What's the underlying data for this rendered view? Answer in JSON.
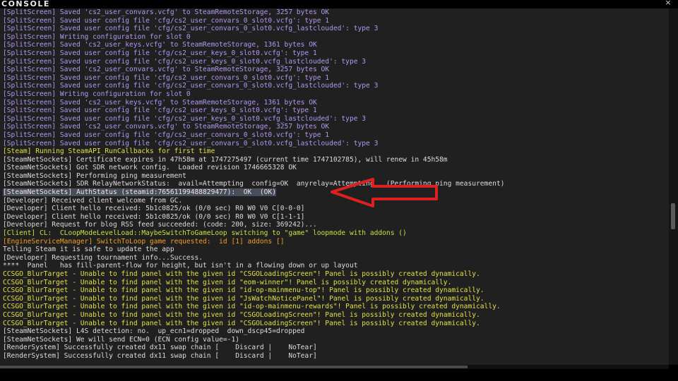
{
  "window": {
    "title": "CONSOLE",
    "close_glyph": "×"
  },
  "console": {
    "lines": [
      {
        "text": "[SplitScreen] Saved 'cs2_user_convars.vcfg' to SteamRemoteStorage, 3257 bytes OK",
        "color": "purple"
      },
      {
        "text": "[SplitScreen] Saved user config file 'cfg/cs2_user_convars_0_slot0.vcfg': type 1",
        "color": "purple"
      },
      {
        "text": "[SplitScreen] Saved user config file 'cfg/cs2_user_convars_0_slot0.vcfg_lastclouded': type 3",
        "color": "purple"
      },
      {
        "text": "[SplitScreen] Writing configuration for slot 0",
        "color": "purple"
      },
      {
        "text": "[SplitScreen] Saved 'cs2_user_keys.vcfg' to SteamRemoteStorage, 1361 bytes OK",
        "color": "purple"
      },
      {
        "text": "[SplitScreen] Saved user config file 'cfg/cs2_user_keys_0_slot0.vcfg': type 1",
        "color": "purple"
      },
      {
        "text": "[SplitScreen] Saved user config file 'cfg/cs2_user_keys_0_slot0.vcfg_lastclouded': type 3",
        "color": "purple"
      },
      {
        "text": "[SplitScreen] Saved 'cs2_user_convars.vcfg' to SteamRemoteStorage, 3257 bytes OK",
        "color": "purple"
      },
      {
        "text": "[SplitScreen] Saved user config file 'cfg/cs2_user_convars_0_slot0.vcfg': type 1",
        "color": "purple"
      },
      {
        "text": "[SplitScreen] Saved user config file 'cfg/cs2_user_convars_0_slot0.vcfg_lastclouded': type 3",
        "color": "purple"
      },
      {
        "text": "[SplitScreen] Writing configuration for slot 0",
        "color": "purple"
      },
      {
        "text": "[SplitScreen] Saved 'cs2_user_keys.vcfg' to SteamRemoteStorage, 1361 bytes OK",
        "color": "purple"
      },
      {
        "text": "[SplitScreen] Saved user config file 'cfg/cs2_user_keys_0_slot0.vcfg': type 1",
        "color": "purple"
      },
      {
        "text": "[SplitScreen] Saved user config file 'cfg/cs2_user_keys_0_slot0.vcfg_lastclouded': type 3",
        "color": "purple"
      },
      {
        "text": "[SplitScreen] Saved 'cs2_user_convars.vcfg' to SteamRemoteStorage, 3257 bytes OK",
        "color": "purple"
      },
      {
        "text": "[SplitScreen] Saved user config file 'cfg/cs2_user_convars_0_slot0.vcfg': type 1",
        "color": "purple"
      },
      {
        "text": "[SplitScreen] Saved user config file 'cfg/cs2_user_convars_0_slot0.vcfg_lastclouded': type 3",
        "color": "purple"
      },
      {
        "text": "[Steam] Running SteamAPI_RunCallbacks for first time",
        "color": "yellow"
      },
      {
        "text": "[SteamNetSockets] Certificate expires in 47h58m at 1747275497 (current time 1747102785), will renew in 45h58m",
        "color": "white"
      },
      {
        "text": "[SteamNetSockets] Got SDR network config.  Loaded revision 1746665328 OK",
        "color": "white"
      },
      {
        "text": "[SteamNetSockets] Performing ping measurement",
        "color": "white"
      },
      {
        "text": "[SteamNetSockets] SDR RelayNetworkStatus:  avail=Attempting  config=OK  anyrelay=Attempting   (Performing ping measurement)",
        "color": "white"
      },
      {
        "text": "[SteamNetSockets] AuthStatus (steamid:76561199488829477):  OK  (OK)",
        "color": "white",
        "highlight": true
      },
      {
        "text": "[Developer] Received client welcome from GC.",
        "color": "white"
      },
      {
        "text": "[Developer] Client hello received: 5b1c0825/ok (0/0 sec) R0 W0 V0 C[0-0-0]",
        "color": "white"
      },
      {
        "text": "[Developer] Client hello received: 5b1c0825/ok (0/0 sec) R0 W0 V0 C[1-1-1]",
        "color": "white"
      },
      {
        "text": "[Developer] Request for blog RSS feed succeeded: (code: 200, size: 369242)...",
        "color": "white"
      },
      {
        "text": "[Client] CL:  CLoopModeLevelLoad::MaybeSwitchToGameLoop switching to \"game\" loopmode with addons ()",
        "color": "ygreen"
      },
      {
        "text": "[EngineServiceManager] SwitchToLoop game requested:  id [1] addons []",
        "color": "orange"
      },
      {
        "text": "Telling Steam it is safe to update the app",
        "color": "white"
      },
      {
        "text": "[Developer] Requesting tournament info...Success.",
        "color": "white"
      },
      {
        "text": "****  Panel   has fill-parent-flow for height, but isn't in a flowing down or up layout",
        "color": "white"
      },
      {
        "text": "CCSGO_BlurTarget - Unable to find panel with the given id \"CSGOLoadingScreen\"! Panel is possibly created dynamically.",
        "color": "yellow"
      },
      {
        "text": "CCSGO_BlurTarget - Unable to find panel with the given id \"eom-winner\"! Panel is possibly created dynamically.",
        "color": "yellow"
      },
      {
        "text": "CCSGO_BlurTarget - Unable to find panel with the given id \"id-op-mainmenu-top\"! Panel is possibly created dynamically.",
        "color": "yellow"
      },
      {
        "text": "CCSGO_BlurTarget - Unable to find panel with the given id \"JsWatchNoticePanel\"! Panel is possibly created dynamically.",
        "color": "yellow"
      },
      {
        "text": "CCSGO_BlurTarget - Unable to find panel with the given id \"id-op-mainmenu-rewards\"! Panel is possibly created dynamically.",
        "color": "yellow"
      },
      {
        "text": "CCSGO_BlurTarget - Unable to find panel with the given id \"CSGOLoadingScreen\"! Panel is possibly created dynamically.",
        "color": "yellow"
      },
      {
        "text": "CCSGO_BlurTarget - Unable to find panel with the given id \"CSGOLoadingScreen\"! Panel is possibly created dynamically.",
        "color": "yellow"
      },
      {
        "text": "[SteamNetSockets] L4S detection: no.  up_ecn1=dropped  down_dscp45=dropped",
        "color": "white"
      },
      {
        "text": "[SteamNetSockets] We will send ECN=0 (ECN config value=-1)",
        "color": "white"
      },
      {
        "text": "[RenderSystem] Successfully created dx11 swap chain [    Discard |    NoTear]",
        "color": "white"
      },
      {
        "text": "[RenderSystem] Successfully created dx11 swap chain [    Discard |    NoTear]",
        "color": "white"
      }
    ]
  },
  "colors": {
    "purple": "#b098f0",
    "yellow": "#e3e042",
    "ygreen": "#c8e040",
    "orange": "#f0a020",
    "white": "#dcdcdc",
    "highlight_bg": "#4a4e5c",
    "annotation_arrow": "#e02020"
  },
  "icons": {
    "close": "close-icon",
    "annotation": "arrow-left-annotation-icon"
  }
}
